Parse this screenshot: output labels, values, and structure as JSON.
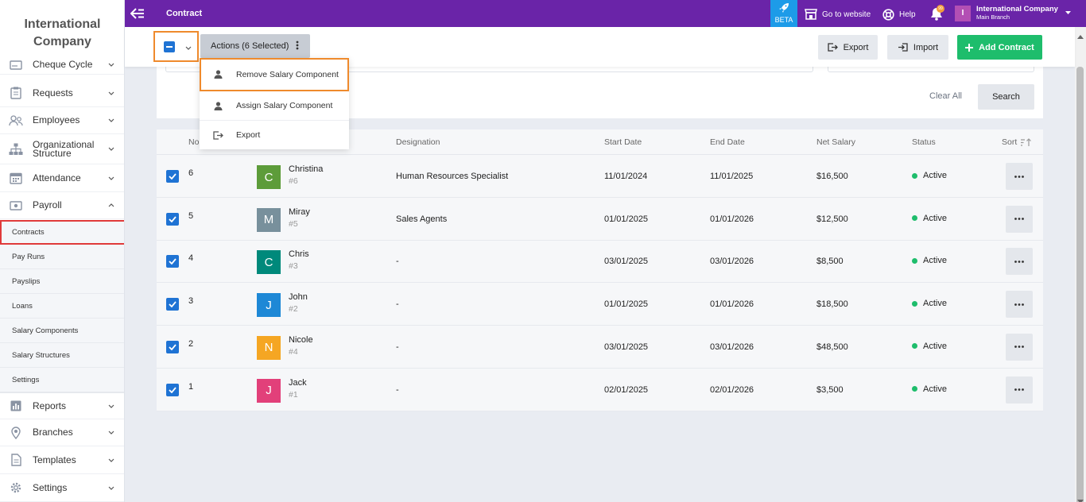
{
  "brand": {
    "name": "International Company"
  },
  "sidebar": {
    "items": [
      {
        "name": "cheque-cycle",
        "label": "Cheque Cycle",
        "icon": "cheque-icon"
      },
      {
        "name": "requests",
        "label": "Requests",
        "icon": "clipboard-icon"
      },
      {
        "name": "employees",
        "label": "Employees",
        "icon": "people-icon"
      },
      {
        "name": "organizational-structure",
        "label": "Organizational Structure",
        "icon": "org-chart-icon"
      },
      {
        "name": "attendance",
        "label": "Attendance",
        "icon": "calendar-icon"
      },
      {
        "name": "payroll",
        "label": "Payroll",
        "icon": "money-icon"
      }
    ],
    "payroll_sub": [
      {
        "name": "contracts",
        "label": "Contracts"
      },
      {
        "name": "pay-runs",
        "label": "Pay Runs"
      },
      {
        "name": "payslips",
        "label": "Payslips"
      },
      {
        "name": "loans",
        "label": "Loans"
      },
      {
        "name": "salary-components",
        "label": "Salary Components"
      },
      {
        "name": "salary-structures",
        "label": "Salary Structures"
      },
      {
        "name": "settings-sub",
        "label": "Settings"
      }
    ],
    "bottom_items": [
      {
        "name": "reports",
        "label": "Reports",
        "icon": "bar-chart-icon"
      },
      {
        "name": "branches",
        "label": "Branches",
        "icon": "location-pin-icon"
      },
      {
        "name": "templates",
        "label": "Templates",
        "icon": "document-icon"
      },
      {
        "name": "settings",
        "label": "Settings",
        "icon": "gear-icon"
      }
    ]
  },
  "topbar": {
    "title": "Contract",
    "beta": "BETA",
    "go_to_website": "Go to website",
    "help": "Help",
    "notification_count": "99",
    "company_name": "International Company",
    "company_branch": "Main Branch",
    "avatar_letter": "I"
  },
  "toolbar": {
    "actions_label": "Actions (6 Selected)",
    "export_label": "Export",
    "import_label": "Import",
    "add_label": "Add Contract"
  },
  "dropdown": {
    "items": [
      {
        "label": "Remove Salary Component",
        "icon": "person-icon"
      },
      {
        "label": "Assign Salary Component",
        "icon": "person-icon"
      },
      {
        "label": "Export",
        "icon": "export-icon"
      }
    ]
  },
  "filters": {
    "clear_all": "Clear All",
    "search": "Search"
  },
  "colors": {
    "primary_purple": "#6a24a8",
    "accent_green": "#1ebd6c",
    "checkbox_blue": "#1f73d4",
    "highlight_orange": "#ef8a2c"
  },
  "table": {
    "headers": {
      "no": "No.",
      "designation": "Designation",
      "start_date": "Start Date",
      "end_date": "End Date",
      "net_salary": "Net Salary",
      "status": "Status",
      "sort": "Sort"
    },
    "rows": [
      {
        "no": "6",
        "initial": "C",
        "color": "#5d9c3a",
        "name": "Christina",
        "id": "#6",
        "designation": "Human Resources Specialist",
        "start": "11/01/2024",
        "end": "11/01/2025",
        "salary": "$16,500",
        "status": "Active"
      },
      {
        "no": "5",
        "initial": "M",
        "color": "#78909c",
        "name": "Miray",
        "id": "#5",
        "designation": "Sales Agents",
        "start": "01/01/2025",
        "end": "01/01/2026",
        "salary": "$12,500",
        "status": "Active"
      },
      {
        "no": "4",
        "initial": "C",
        "color": "#00897b",
        "name": "Chris",
        "id": "#3",
        "designation": "-",
        "start": "03/01/2025",
        "end": "03/01/2026",
        "salary": "$8,500",
        "status": "Active"
      },
      {
        "no": "3",
        "initial": "J",
        "color": "#1e88d6",
        "name": "John",
        "id": "#2",
        "designation": "-",
        "start": "01/01/2025",
        "end": "01/01/2026",
        "salary": "$18,500",
        "status": "Active"
      },
      {
        "no": "2",
        "initial": "N",
        "color": "#f5a623",
        "name": "Nicole",
        "id": "#4",
        "designation": "-",
        "start": "03/01/2025",
        "end": "03/01/2026",
        "salary": "$48,500",
        "status": "Active"
      },
      {
        "no": "1",
        "initial": "J",
        "color": "#e2407a",
        "name": "Jack",
        "id": "#1",
        "designation": "-",
        "start": "02/01/2025",
        "end": "02/01/2026",
        "salary": "$3,500",
        "status": "Active"
      }
    ]
  }
}
